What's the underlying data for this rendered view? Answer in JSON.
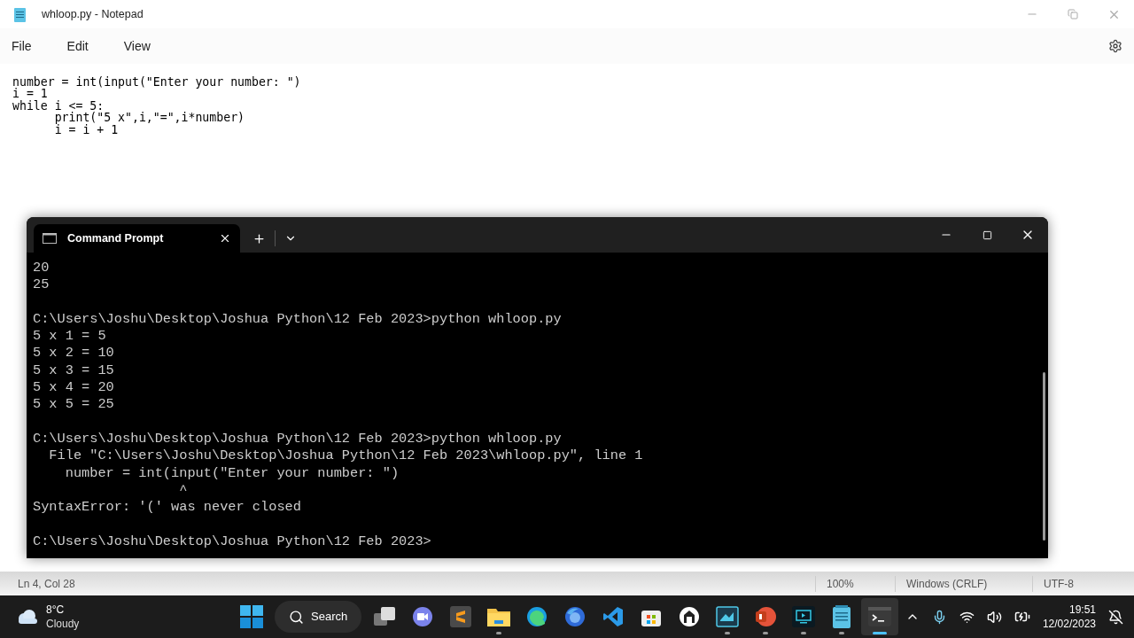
{
  "notepad": {
    "title": "whloop.py - Notepad",
    "menu": [
      "File",
      "Edit",
      "View"
    ],
    "lines": [
      "number = int(input(\"Enter your number: \")",
      "i = 1",
      "while i <= 5:",
      "      print(\"5 x\",i,\"=\",i*number)",
      "      i = i + 1"
    ],
    "status_bar": {
      "position": "Ln 4, Col 28",
      "zoom": "100%",
      "line_ending": "Windows (CRLF)",
      "encoding": "UTF-8"
    }
  },
  "terminal": {
    "tab_title": "Command Prompt",
    "selected": true,
    "blocks": [
      [
        "20",
        "25"
      ],
      [
        "C:\\Users\\Joshu\\Desktop\\Joshua Python\\12 Feb 2023>python whloop.py",
        "5 x 1 = 5",
        "5 x 2 = 10",
        "5 x 3 = 15",
        "5 x 4 = 20",
        "5 x 5 = 25"
      ],
      [
        "C:\\Users\\Joshu\\Desktop\\Joshua Python\\12 Feb 2023>python whloop.py",
        "  File \"C:\\Users\\Joshu\\Desktop\\Joshua Python\\12 Feb 2023\\whloop.py\", line 1",
        "    number = int(input(\"Enter your number: \")",
        "                  ^",
        "SyntaxError: '(' was never closed"
      ],
      [
        "C:\\Users\\Joshu\\Desktop\\Joshua Python\\12 Feb 2023>"
      ]
    ]
  },
  "taskbar": {
    "weather": {
      "temperature": "8°C",
      "condition": "Cloudy"
    },
    "search": "Search",
    "apps": [
      {
        "kind": "start",
        "running": false,
        "selected": false
      },
      {
        "kind": "taskview",
        "running": false,
        "selected": false
      },
      {
        "kind": "chat",
        "running": false,
        "selected": false
      },
      {
        "kind": "sublime",
        "running": false,
        "selected": false
      },
      {
        "kind": "explorer",
        "running": true,
        "selected": false
      },
      {
        "kind": "edge",
        "running": false,
        "selected": false
      },
      {
        "kind": "firefox",
        "running": false,
        "selected": false
      },
      {
        "kind": "vscode",
        "running": false,
        "selected": false
      },
      {
        "kind": "store",
        "running": false,
        "selected": false
      },
      {
        "kind": "house",
        "running": false,
        "selected": false
      },
      {
        "kind": "recorder",
        "running": true,
        "selected": false
      },
      {
        "kind": "powerpoint",
        "running": true,
        "selected": false
      },
      {
        "kind": "screen",
        "running": true,
        "selected": false
      },
      {
        "kind": "notepad",
        "running": true,
        "selected": false
      },
      {
        "kind": "terminal",
        "running": true,
        "selected": true
      }
    ],
    "time": "19:51",
    "date": "12/02/2023"
  }
}
